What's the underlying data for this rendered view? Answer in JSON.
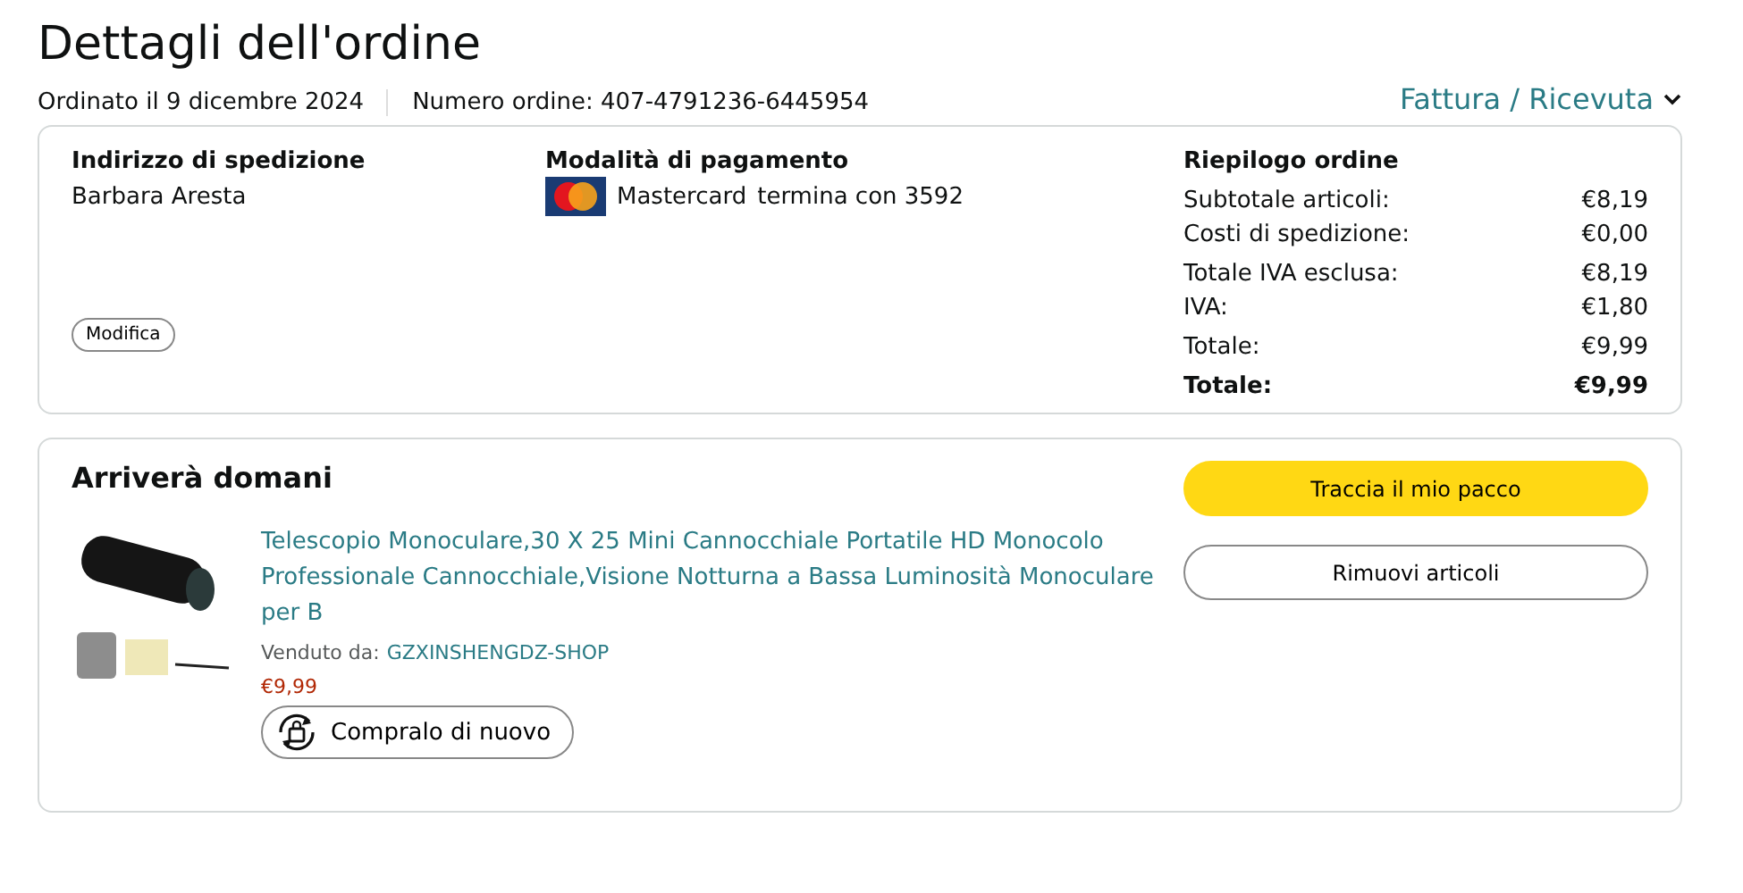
{
  "title": "Dettagli dell'ordine",
  "meta": {
    "ordered": "Ordinato il 9 dicembre 2024",
    "order_number": "Numero ordine: 407-4791236-6445954",
    "invoice_link": "Fattura / Ricevuta"
  },
  "shipping": {
    "heading": "Indirizzo di spedizione",
    "name": "Barbara Aresta",
    "edit_button": "Modifica"
  },
  "payment": {
    "heading": "Modalità di pagamento",
    "card": "Mastercard",
    "ending": "termina con 3592"
  },
  "summary": {
    "heading": "Riepilogo ordine",
    "groups": [
      [
        {
          "label": "Subtotale articoli:",
          "value": "€8,19",
          "bold": false
        },
        {
          "label": "Costi di spedizione:",
          "value": "€0,00",
          "bold": false
        }
      ],
      [
        {
          "label": "Totale IVA esclusa:",
          "value": "€8,19",
          "bold": false
        },
        {
          "label": "IVA:",
          "value": "€1,80",
          "bold": false
        }
      ],
      [
        {
          "label": "Totale:",
          "value": "€9,99",
          "bold": false
        }
      ],
      [
        {
          "label": "Totale:",
          "value": "€9,99",
          "bold": true
        }
      ]
    ]
  },
  "shipment": {
    "heading": "Arriverà domani",
    "item": {
      "title": "Telescopio Monoculare,30 X 25 Mini Cannocchiale Portatile HD Monocolo Professionale Cannocchiale,Visione Notturna a Bassa Luminosità Monoculare per B",
      "sold_by_label": "Venduto da:",
      "seller": "GZXINSHENGDZ-SHOP",
      "price": "€9,99",
      "buy_again": "Compralo di nuovo"
    },
    "buttons": [
      {
        "label": "Traccia il mio pacco",
        "kind": "primary"
      },
      {
        "label": "Rimuovi articoli",
        "kind": "secondary"
      }
    ]
  }
}
